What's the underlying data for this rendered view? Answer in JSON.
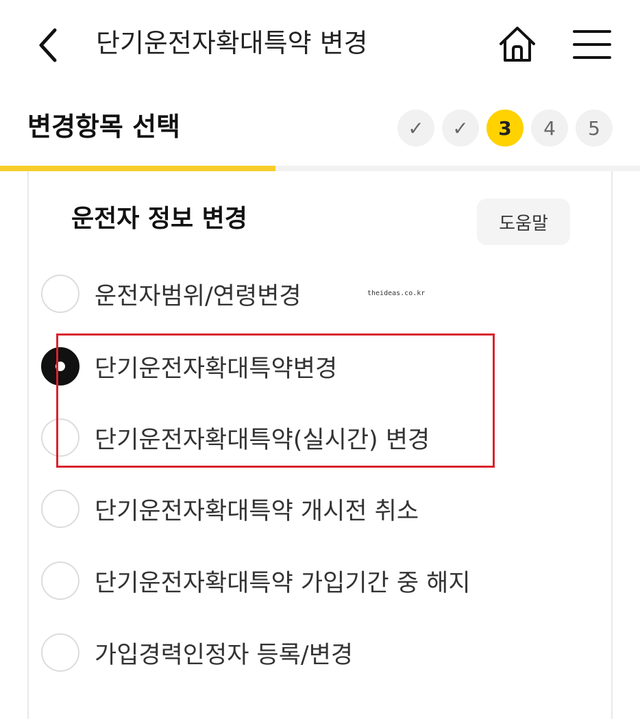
{
  "header": {
    "title": "단기운전자확대특약 변경",
    "back_icon": "chevron-left-icon",
    "home_icon": "home-icon",
    "menu_icon": "hamburger-menu-icon"
  },
  "step_header": {
    "title": "변경항목 선택",
    "steps": [
      {
        "label": "✓",
        "state": "done"
      },
      {
        "label": "✓",
        "state": "done"
      },
      {
        "label": "3",
        "state": "current"
      },
      {
        "label": "4",
        "state": "pending"
      },
      {
        "label": "5",
        "state": "pending"
      }
    ],
    "progress_percent": 43
  },
  "section": {
    "title": "운전자 정보 변경",
    "help_label": "도움말"
  },
  "options": [
    {
      "label": "운전자범위/연령변경",
      "selected": false
    },
    {
      "label": "단기운전자확대특약변경",
      "selected": true
    },
    {
      "label": "단기운전자확대특약(실시간) 변경",
      "selected": false
    },
    {
      "label": "단기운전자확대특약 개시전 취소",
      "selected": false
    },
    {
      "label": "단기운전자확대특약 가입기간 중 해지",
      "selected": false
    },
    {
      "label": "가입경력인정자 등록/변경",
      "selected": false
    }
  ],
  "watermark": "theideas.co.kr",
  "colors": {
    "accent": "#ffd200",
    "progress": "#f7cd2b",
    "highlight": "#d9232d"
  }
}
